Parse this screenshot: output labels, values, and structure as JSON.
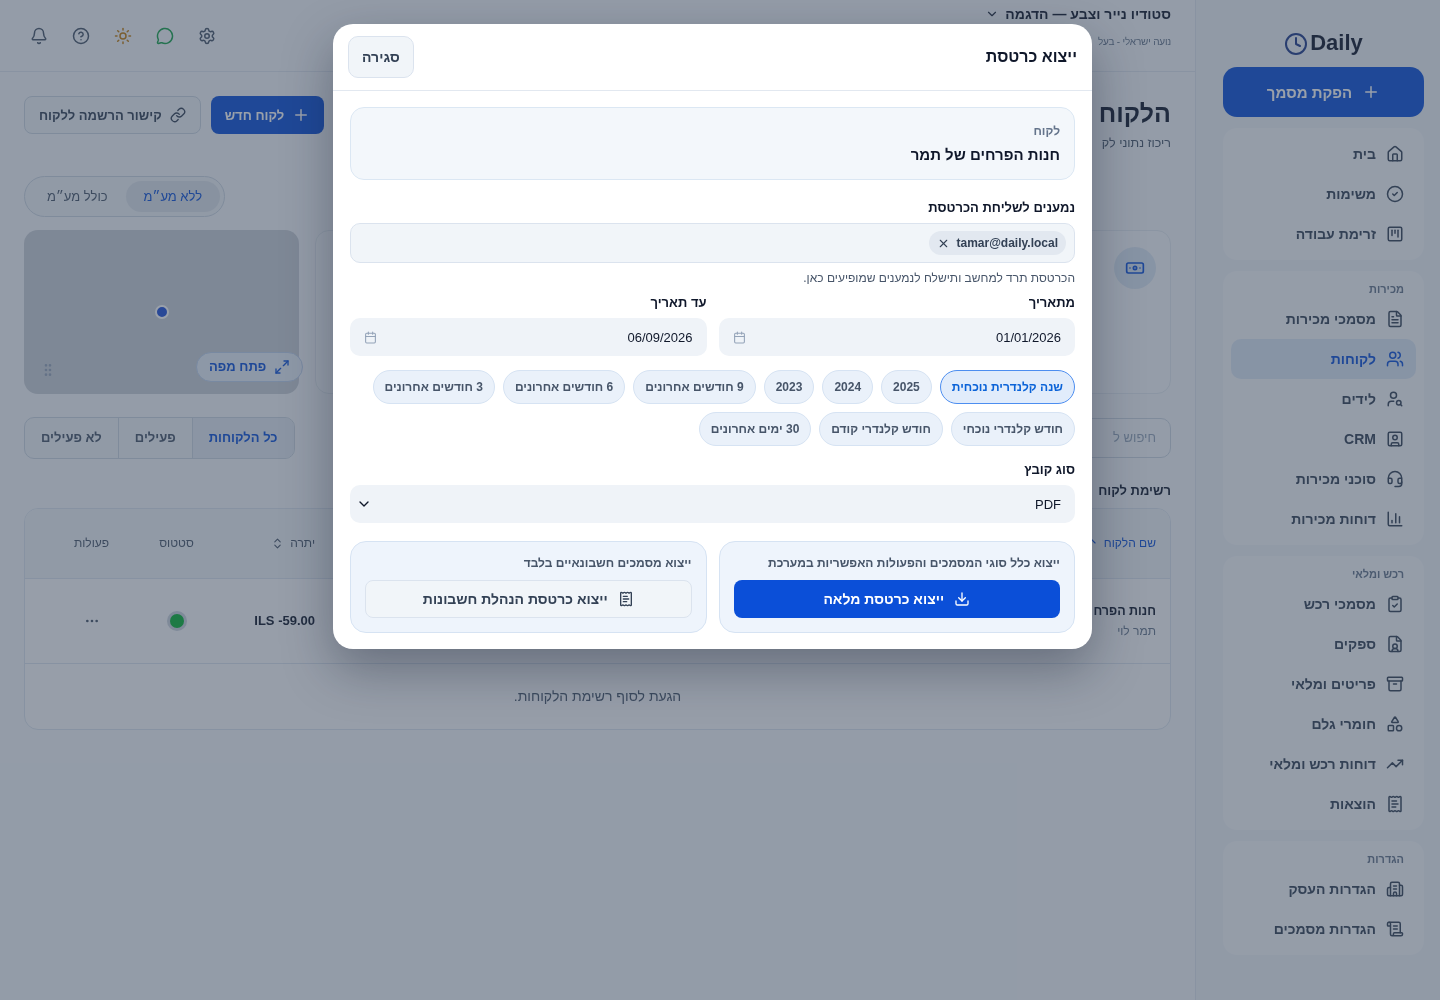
{
  "topbar": {
    "business_name": "סטודיו נייר וצבע — הדגמה",
    "user": "נועה ישראלי - בעל"
  },
  "page": {
    "title": "הלקוח",
    "subtitle": "ריכוז נתוני לק",
    "actions": [
      {
        "label": "לקוח חדש",
        "kind": "primary"
      },
      {
        "label": "קישור הרשמה ללקוח",
        "kind": "secondary"
      }
    ]
  },
  "vat_toggle": [
    {
      "label": "ללא מע״מ",
      "selected": true
    },
    {
      "label": "כולל מע״מ",
      "selected": false
    }
  ],
  "map": {
    "open_label": "פתח מפה"
  },
  "search": {
    "placeholder": "חיפוש ל"
  },
  "filter_tabs": [
    {
      "label": "כל הלקוחות",
      "selected": true
    },
    {
      "label": "פעילים",
      "selected": false
    },
    {
      "label": "לא פעילים",
      "selected": false
    }
  ],
  "list": {
    "title": "רשימת לקוח",
    "columns": [
      {
        "label": "שם הלקוח",
        "sortable": true,
        "sorted": true
      },
      {
        "label": "יתרה",
        "sortable": true,
        "sorted": false
      },
      {
        "label": "סטטוס"
      },
      {
        "label": "פעולות"
      }
    ],
    "rows": [
      {
        "name": "חנות הפרח",
        "contact": "תמר לוי",
        "balance": "ILS -59.00",
        "color": "#1d7a45"
      }
    ],
    "end_note": "הגעת לסוף רשימת הלקוחות."
  },
  "sidebar": {
    "logo": "Daily",
    "create_button": "הפקת מסמך",
    "groups": [
      {
        "items": [
          {
            "label": "בית",
            "selected": false
          },
          {
            "label": "משימות",
            "selected": false
          },
          {
            "label": "זרימת עבודה",
            "selected": false
          }
        ]
      },
      {
        "title": "מכירות",
        "items": [
          {
            "label": "מסמכי מכירות",
            "selected": false
          },
          {
            "label": "לקוחות",
            "selected": true
          },
          {
            "label": "לידים",
            "selected": false
          },
          {
            "label": "CRM",
            "selected": false
          },
          {
            "label": "סוכני מכירות",
            "selected": false
          },
          {
            "label": "דוחות מכירות",
            "selected": false
          }
        ]
      },
      {
        "title": "רכש ומלאי",
        "items": [
          {
            "label": "מסמכי רכש",
            "selected": false
          },
          {
            "label": "ספקים",
            "selected": false
          },
          {
            "label": "פריטים ומלאי",
            "selected": false
          },
          {
            "label": "חומרי גלם",
            "selected": false
          },
          {
            "label": "דוחות רכש ומלאי",
            "selected": false
          },
          {
            "label": "הוצאות",
            "selected": false
          }
        ]
      },
      {
        "title": "הגדרות",
        "items": [
          {
            "label": "הגדרות העסק",
            "selected": false
          },
          {
            "label": "הגדרות מסמכים",
            "selected": false
          }
        ]
      }
    ]
  },
  "modal": {
    "title": "ייצוא כרטסת",
    "close": "סגירה",
    "customer_label": "לקוח",
    "customer_name": "חנות הפרחים של תמר",
    "recipients_label": "נמענים לשליחת הכרטסת",
    "recipients": [
      "tamar@daily.local"
    ],
    "recipients_hint": "הכרטסת תרד למחשב ותישלח לנמענים שמופיעים כאן.",
    "from_label": "מתאריך",
    "from_value": "01/01/2026",
    "to_label": "עד תאריך",
    "to_value": "06/09/2026",
    "presets": [
      {
        "label": "שנה קלנדרית נוכחית",
        "selected": true
      },
      {
        "label": "2025",
        "selected": false
      },
      {
        "label": "2024",
        "selected": false
      },
      {
        "label": "2023",
        "selected": false
      },
      {
        "label": "9 חודשים אחרונים",
        "selected": false
      },
      {
        "label": "6 חודשים אחרונים",
        "selected": false
      },
      {
        "label": "3 חודשים אחרונים",
        "selected": false
      },
      {
        "label": "חודש קלנדרי נוכחי",
        "selected": false
      },
      {
        "label": "חודש קלנדרי קודם",
        "selected": false
      },
      {
        "label": "30 ימים אחרונים",
        "selected": false
      }
    ],
    "file_type_label": "סוג קובץ",
    "file_type": "PDF",
    "exports": [
      {
        "description": "ייצוא כלל סוגי המסמכים והפעולות האפשריות במערכת",
        "button": "ייצוא כרטסת מלאה",
        "kind": "primary"
      },
      {
        "description": "ייצוא מסמכים חשבונאיים בלבד",
        "button": "ייצוא כרטסת הנהלת חשבונות",
        "kind": "secondary"
      }
    ]
  }
}
